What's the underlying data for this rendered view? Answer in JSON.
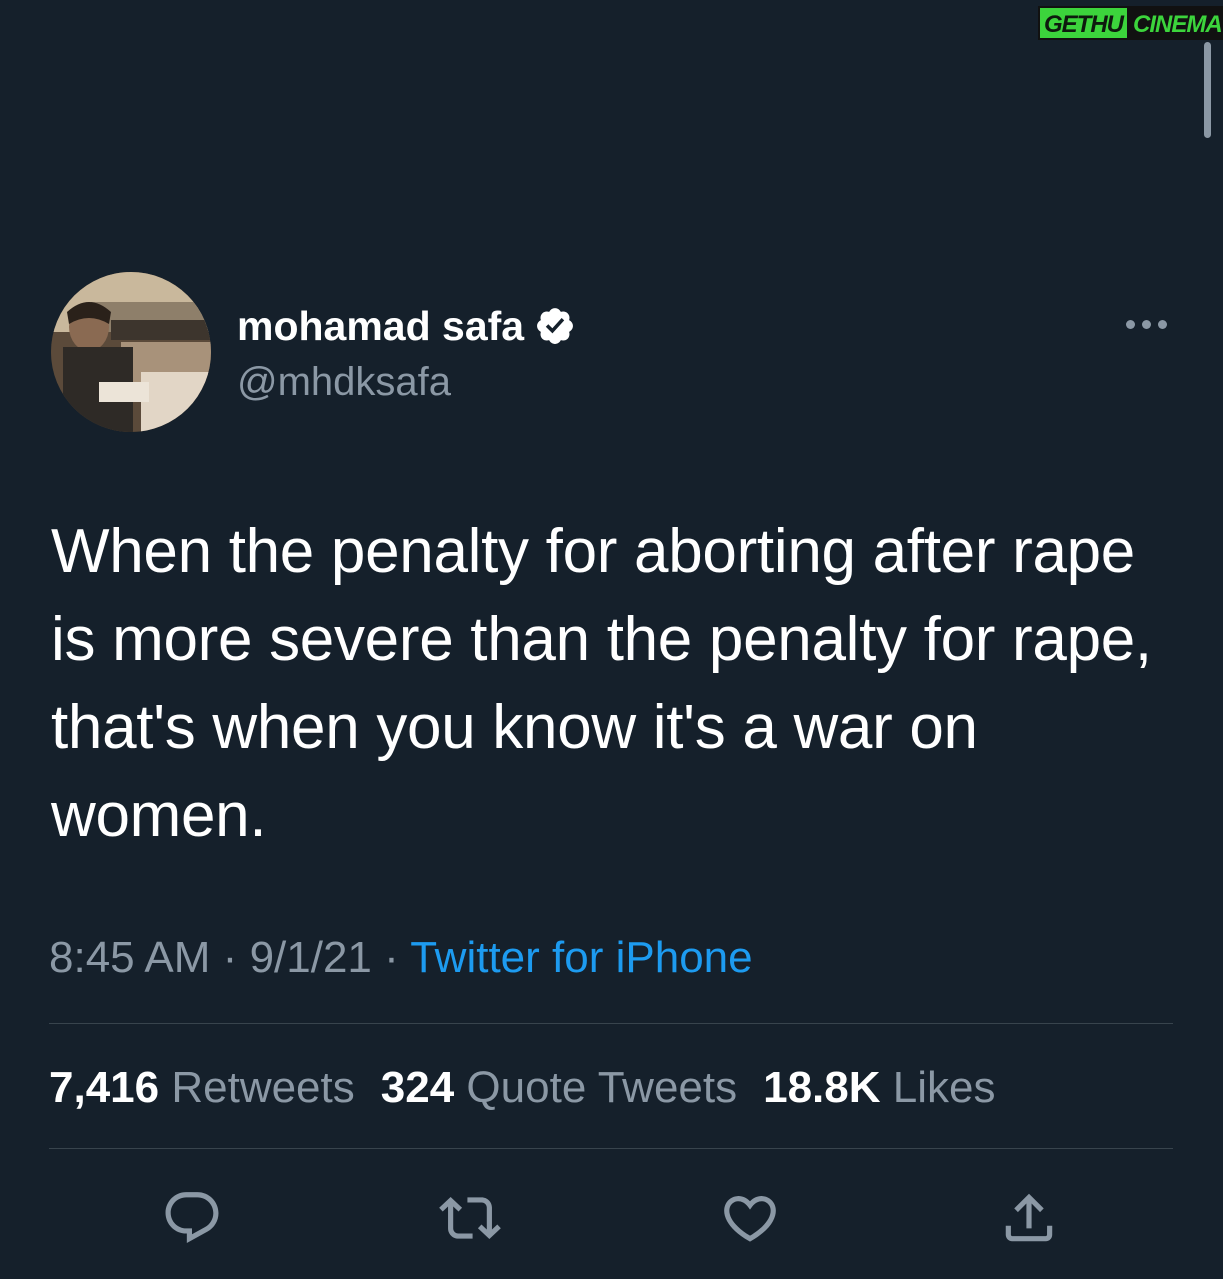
{
  "watermark": {
    "left_text": "GETHU",
    "right_text": "CINEMA"
  },
  "tweet": {
    "author": {
      "display_name": "mohamad safa",
      "handle": "@mhdksafa",
      "verified": true
    },
    "text": "When the penalty for aborting after rape is more severe than the penalty for rape, that's when you know it's a war on women.",
    "time": "8:45 AM",
    "date": "9/1/21",
    "separator": "·",
    "source": "Twitter for iPhone",
    "stats": {
      "retweets_count": "7,416",
      "retweets_label": "Retweets",
      "quote_tweets_count": "324",
      "quote_tweets_label": "Quote Tweets",
      "likes_count": "18.8K",
      "likes_label": "Likes"
    },
    "actions": {
      "reply_icon": "reply-icon",
      "retweet_icon": "retweet-icon",
      "like_icon": "heart-icon",
      "share_icon": "share-icon"
    }
  },
  "colors": {
    "background": "#15202b",
    "text_primary": "#ffffff",
    "text_secondary": "#8b98a5",
    "accent": "#1d9bf0",
    "divider": "#38444d",
    "watermark_green": "#3cd43c"
  }
}
